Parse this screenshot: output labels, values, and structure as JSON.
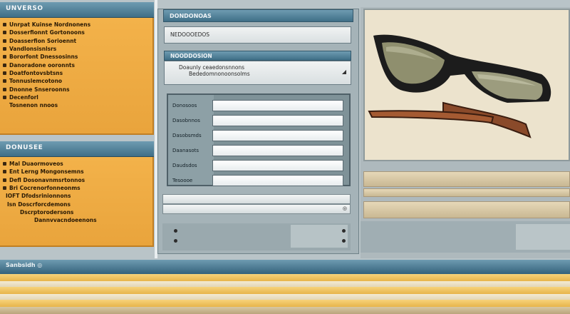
{
  "top_left_panel": {
    "title": "UNVERSO",
    "items": [
      "Unrpat Kuinse Nordnonens",
      "Dosserfionnt Gortonoons",
      "Doasserfion Sorioennt",
      "Vandlonsisnlsrs",
      "Bororfont Dnessosinns",
      "Danoradone ooronnts",
      "Doatfontovsbtsns",
      "Tonnuslemcotono",
      "Dnonne Snseroonns",
      "Decenforl",
      "Tosnenon nnoos"
    ]
  },
  "bottom_left_panel": {
    "title": "DONUSEE",
    "items": [
      "Mal Duaormoveos",
      "Ent Lerng Mongonsemns",
      "Defl Dosonavnmsrtonnos",
      "Bri Cocrenorfonneonms",
      "IOFT Dfodsrinionnons",
      "Isn Doscrforcdemons",
      "Dscrptorodersons",
      "Dannvvacndoeenons"
    ]
  },
  "middle": {
    "header": "DONDONOAS",
    "field1_value": "NEDOOOEDOS",
    "section_header": "NOODDOSION",
    "dropdown_line1": "Doaunly ceaedonsnnons",
    "dropdown_line2": "Bededomnonoonsolms",
    "dropdown_arrow": "◢",
    "form_labels": [
      "Donosoos",
      "Dasobnnos",
      "Dasobsmds",
      "Daanasots",
      "Daudsdos",
      "Tesoooe"
    ],
    "footer_glyph": "◎"
  },
  "bottom_bar": {
    "title": "Sanbsidh ◎"
  },
  "colors": {
    "accent_blue": "#3f6f87",
    "panel_orange": "#f3b24a",
    "image_bg": "#ece3cd"
  }
}
